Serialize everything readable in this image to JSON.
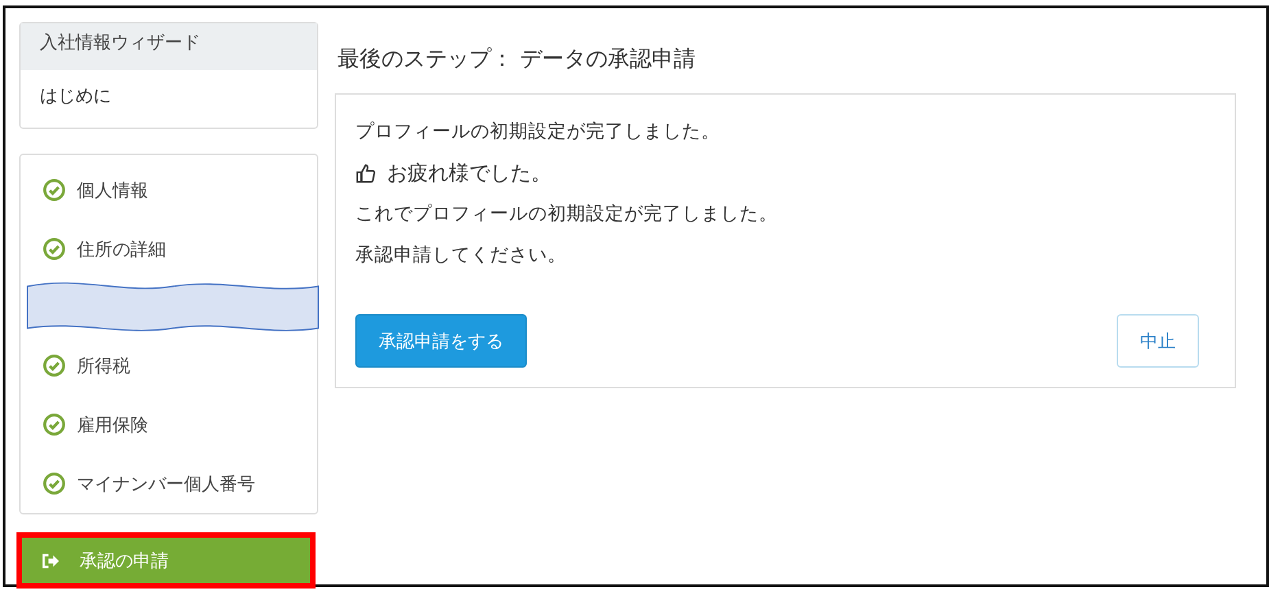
{
  "sidebar": {
    "wizard_title": "入社情報ウィザード",
    "intro": "はじめに",
    "steps": [
      {
        "kind": "step",
        "label": "個人情報",
        "done": true
      },
      {
        "kind": "step",
        "label": "住所の詳細",
        "done": true
      },
      {
        "kind": "omission"
      },
      {
        "kind": "step",
        "label": "所得税",
        "done": true
      },
      {
        "kind": "step",
        "label": "雇用保険",
        "done": true
      },
      {
        "kind": "step",
        "label": "マイナンバー個人番号",
        "done": true
      }
    ],
    "current_step": {
      "label": "承認の申請",
      "selected": true,
      "highlighted": true
    }
  },
  "main": {
    "heading": "最後のステップ： データの承認申請",
    "messages": [
      {
        "kind": "text",
        "text": "プロフィールの初期設定が完了しました。"
      },
      {
        "kind": "thumbs",
        "text": "お疲れ様でした。"
      },
      {
        "kind": "text",
        "text": "これでプロフィールの初期設定が完了しました。"
      },
      {
        "kind": "text",
        "text": "承認申請してください。"
      }
    ],
    "buttons": [
      {
        "kind": "primary",
        "label": "承認申請をする"
      },
      {
        "kind": "outline",
        "label": "中止"
      }
    ]
  }
}
